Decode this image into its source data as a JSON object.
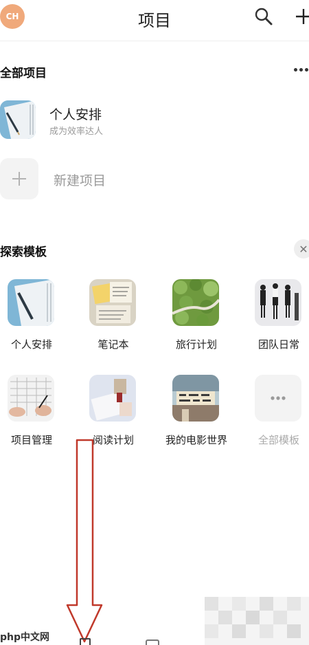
{
  "header": {
    "avatar_initials": "CH",
    "title": "项目",
    "search_icon": "search-icon",
    "add_icon": "plus-icon"
  },
  "all_projects": {
    "title": "全部项目",
    "more_icon": "more-icon",
    "items": [
      {
        "name": "个人安排",
        "subtitle": "成为效率达人",
        "thumb": "notebook-pen-image"
      }
    ],
    "new_project": {
      "label": "新建项目",
      "icon": "plus-icon"
    }
  },
  "templates": {
    "title": "探索模板",
    "close_icon": "close-icon",
    "items": [
      {
        "label": "个人安排",
        "thumb": "notebook-pen-image"
      },
      {
        "label": "笔记本",
        "thumb": "sticky-notes-image"
      },
      {
        "label": "旅行计划",
        "thumb": "forest-road-image"
      },
      {
        "label": "团队日常",
        "thumb": "team-people-image"
      },
      {
        "label": "项目管理",
        "thumb": "calendar-hands-image"
      },
      {
        "label": "阅读计划",
        "thumb": "book-image"
      },
      {
        "label": "我的电影世界",
        "thumb": "cinema-image"
      },
      {
        "label": "全部模板",
        "thumb": "more-icon"
      }
    ]
  },
  "watermark": "php中文网",
  "colors": {
    "avatar": "#f0a97b",
    "arrow": "#c0392b",
    "muted_text": "#9a9a9a"
  }
}
